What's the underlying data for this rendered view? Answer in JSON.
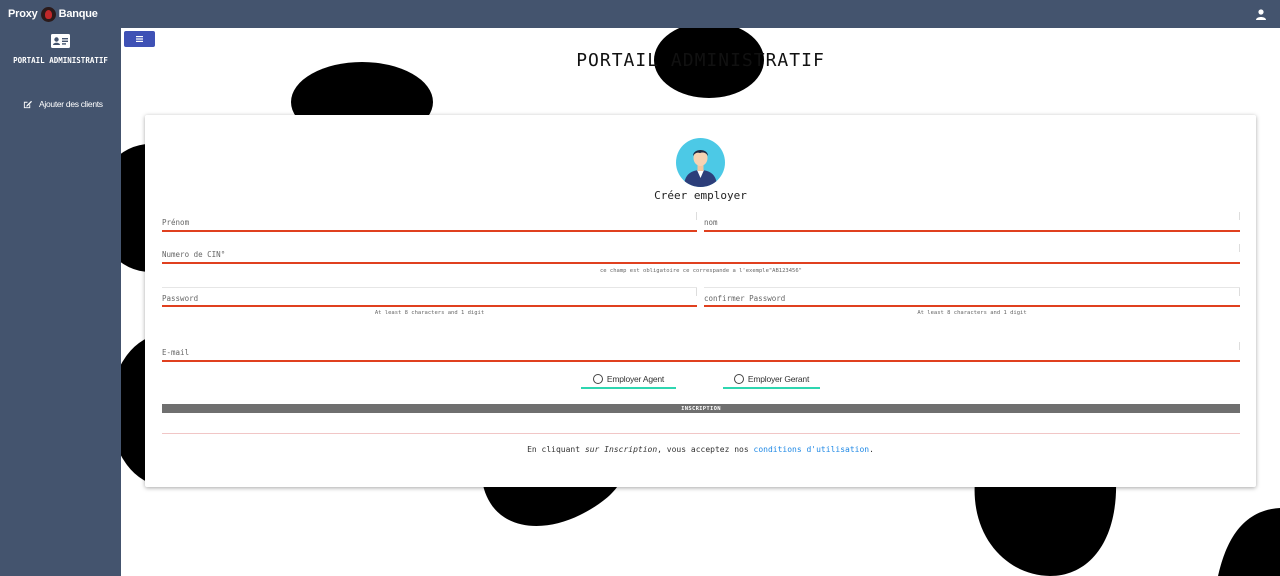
{
  "header": {
    "brand_left": "Proxy",
    "brand_right": "Banque"
  },
  "sidebar": {
    "title": "PORTAIL ADMINISTRATIF",
    "items": [
      {
        "label": "Ajouter des clients",
        "icon": "edit-icon"
      }
    ]
  },
  "page": {
    "title": "PORTAIL ADMINISTRATIF"
  },
  "form": {
    "title": "Créer employer",
    "prenom_placeholder": "Prénom",
    "nom_placeholder": "nom",
    "cin_placeholder": "Numero de CIN°",
    "cin_hint": "ce champ est obligatoire ce correspande a l'exemple\"AB123456\"",
    "password_placeholder": "Password",
    "password_hint": "At least 8 characters and 1 digit",
    "confirm_placeholder": "confirmer Password",
    "confirm_hint": "At least 8 characters and 1 digit",
    "email_placeholder": "E-mail",
    "radio_agent": "Employer Agent",
    "radio_gerant": "Employer Gerant",
    "submit_label": "INSCRIPTION",
    "terms_prefix": "En cliquant",
    "terms_sur": "sur",
    "terms_inscription": "Inscription",
    "terms_middle": ", vous acceptez nos",
    "terms_link": "conditions d'utilisation",
    "terms_suffix": "."
  },
  "colors": {
    "navbar": "#44546e",
    "menu_button": "#3f51b5",
    "field_underline": "#e0401f",
    "radio_underline": "#2ed6b0",
    "link": "#1e88e5"
  }
}
